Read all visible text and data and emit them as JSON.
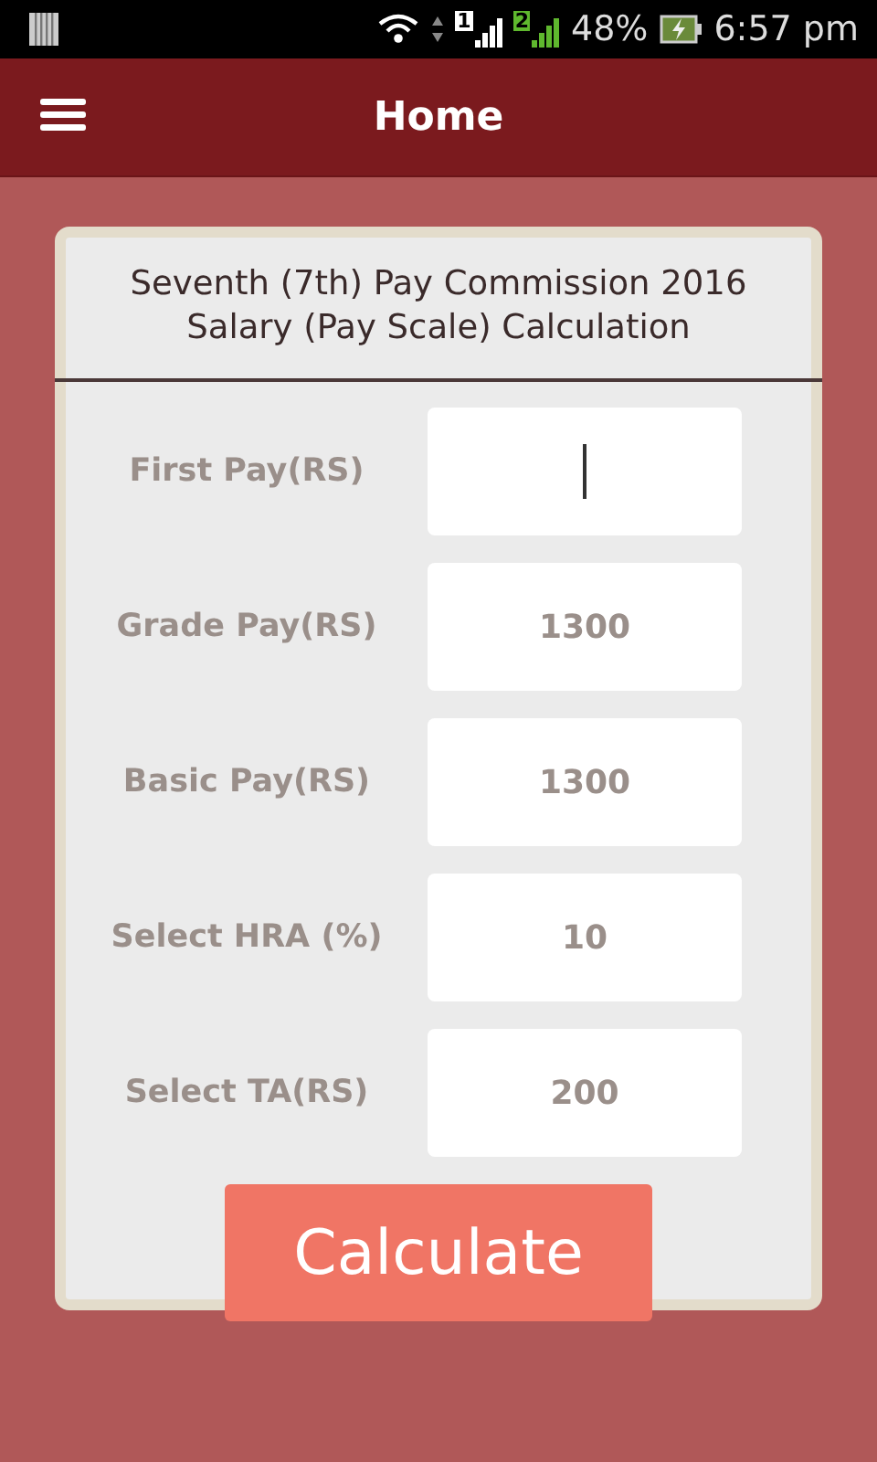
{
  "status_bar": {
    "sims": [
      {
        "label": "1",
        "color": "#ffffff"
      },
      {
        "label": "2",
        "color": "#5fb82e"
      }
    ],
    "battery": "48%",
    "time": "6:57 pm"
  },
  "app_bar": {
    "title": "Home"
  },
  "card": {
    "title": "Seventh (7th) Pay Commission 2016 Salary (Pay Scale) Calculation",
    "fields": [
      {
        "label": "First Pay(RS)",
        "focused": true
      },
      {
        "label": "Grade Pay(RS)",
        "value": "1300",
        "focused": false
      },
      {
        "label": "Basic Pay(RS)",
        "value": "1300",
        "focused": false
      },
      {
        "label": "Select HRA (%)",
        "value": "10",
        "focused": false
      },
      {
        "label": "Select TA(RS)",
        "value": "200",
        "focused": false
      }
    ],
    "button": "Calculate"
  }
}
